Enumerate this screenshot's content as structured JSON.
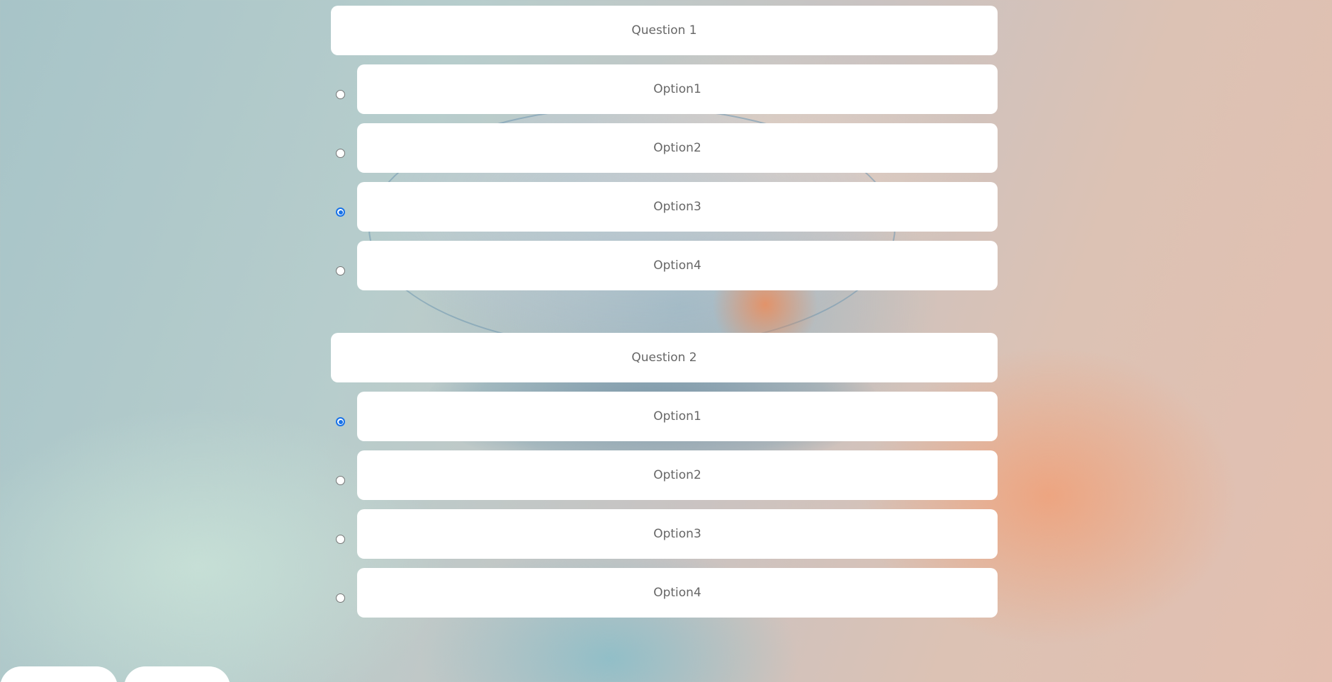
{
  "questions": [
    {
      "title": "Question 1",
      "options": [
        {
          "label": "Option1",
          "selected": false
        },
        {
          "label": "Option2",
          "selected": false
        },
        {
          "label": "Option3",
          "selected": true
        },
        {
          "label": "Option4",
          "selected": false
        }
      ]
    },
    {
      "title": "Question 2",
      "options": [
        {
          "label": "Option1",
          "selected": true
        },
        {
          "label": "Option2",
          "selected": false
        },
        {
          "label": "Option3",
          "selected": false
        },
        {
          "label": "Option4",
          "selected": false
        }
      ]
    }
  ],
  "colors": {
    "card": "#ffffff",
    "text": "#666666",
    "radio_selected": "#1a73e8"
  }
}
